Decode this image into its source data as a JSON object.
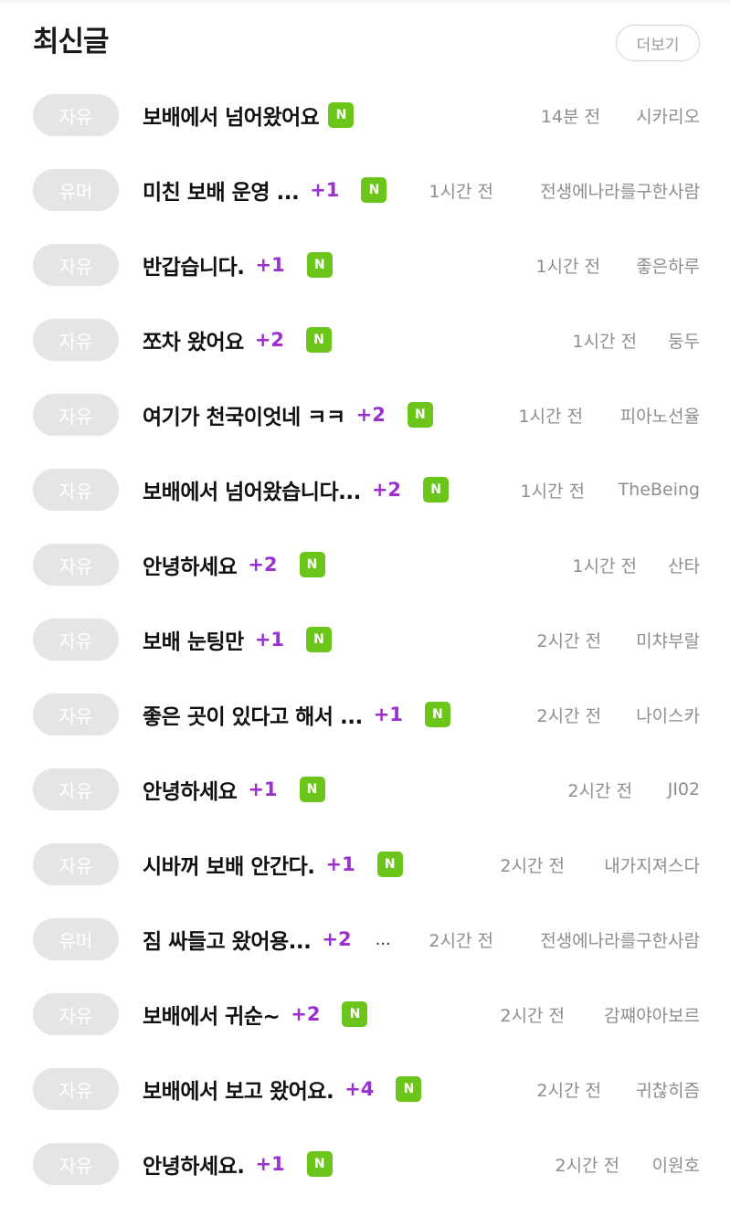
{
  "header": {
    "title": "최신글",
    "more_label": "더보기"
  },
  "colors": {
    "accent_purple": "#9b2fd1",
    "new_badge_green": "#6cc51a",
    "category_badge_bg": "#e5e5e5",
    "meta_text": "#8e8e8e"
  },
  "new_label": "N",
  "ellipsis_label": "...",
  "posts": [
    {
      "category": "자유",
      "title": "보배에서 넘어왔어요",
      "comments": "",
      "new": true,
      "time": "14분 전",
      "author": "시카리오"
    },
    {
      "category": "유머",
      "title": "미친 보배 운영 ...",
      "comments": "+1",
      "new": true,
      "time": "1시간 전",
      "author": "전생에나라를구한사람"
    },
    {
      "category": "자유",
      "title": "반갑습니다.",
      "comments": "+1",
      "new": true,
      "time": "1시간 전",
      "author": "좋은하루"
    },
    {
      "category": "자유",
      "title": "쪼차 왔어요",
      "comments": "+2",
      "new": true,
      "time": "1시간 전",
      "author": "둥두"
    },
    {
      "category": "자유",
      "title": "여기가 천국이엇네 ㅋㅋ",
      "comments": "+2",
      "new": true,
      "time": "1시간 전",
      "author": "피아노선율"
    },
    {
      "category": "자유",
      "title": "보배에서 넘어왔습니다...",
      "comments": "+2",
      "new": true,
      "time": "1시간 전",
      "author": "TheBeing"
    },
    {
      "category": "자유",
      "title": "안녕하세요",
      "comments": "+2",
      "new": true,
      "time": "1시간 전",
      "author": "산타"
    },
    {
      "category": "자유",
      "title": "보배 눈팅만",
      "comments": "+1",
      "new": true,
      "time": "2시간 전",
      "author": "미챠부랄"
    },
    {
      "category": "자유",
      "title": "좋은 곳이 있다고 해서 ...",
      "comments": "+1",
      "new": true,
      "time": "2시간 전",
      "author": "나이스카"
    },
    {
      "category": "자유",
      "title": "안녕하세요",
      "comments": "+1",
      "new": true,
      "time": "2시간 전",
      "author": "JI02"
    },
    {
      "category": "자유",
      "title": "시바꺼 보배 안간다.",
      "comments": "+1",
      "new": true,
      "time": "2시간 전",
      "author": "내가지져스다"
    },
    {
      "category": "유머",
      "title": "짐 싸들고 왔어용...",
      "comments": "+2",
      "new": false,
      "dots": true,
      "time": "2시간 전",
      "author": "전생에나라를구한사람"
    },
    {
      "category": "자유",
      "title": "보배에서 귀순~",
      "comments": "+2",
      "new": true,
      "time": "2시간 전",
      "author": "감쨰야아보르"
    },
    {
      "category": "자유",
      "title": "보배에서 보고 왔어요.",
      "comments": "+4",
      "new": true,
      "time": "2시간 전",
      "author": "귀찮히즘"
    },
    {
      "category": "자유",
      "title": "안녕하세요.",
      "comments": "+1",
      "new": true,
      "time": "2시간 전",
      "author": "이원호"
    }
  ]
}
